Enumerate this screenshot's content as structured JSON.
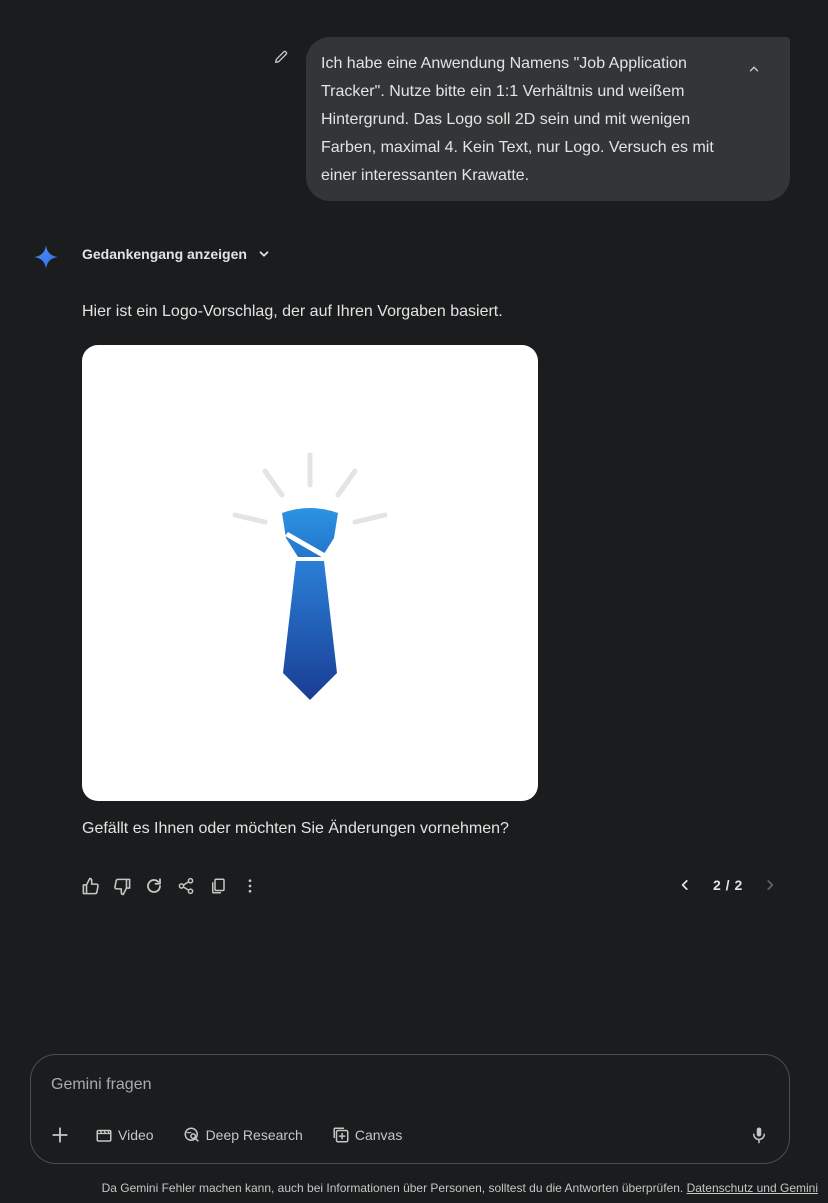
{
  "user_prompt": {
    "text": "Ich habe eine Anwendung Namens \"Job Application Tracker\". Nutze bitte ein 1:1 Verhältnis und weißem Hintergrund. Das Logo soll 2D sein und mit wenigen Farben, maximal 4. Kein Text, nur Logo. Versuch es mit einer interessanten Krawatte."
  },
  "response": {
    "thoughts_label": "Gedankengang anzeigen",
    "intro": "Hier ist ein Logo-Vorschlag, der auf Ihren Vorgaben basiert.",
    "question": "Gefällt es Ihnen oder möchten Sie Änderungen vornehmen?",
    "pager": "2 / 2"
  },
  "input": {
    "placeholder": "Gemini fragen",
    "tools": {
      "video": "Video",
      "deep_research": "Deep Research",
      "canvas": "Canvas"
    }
  },
  "footer": {
    "disclaimer": "Da Gemini Fehler machen kann, auch bei Informationen über Personen, solltest du die Antworten überprüfen.",
    "privacy_link": "Datenschutz und Gemini"
  },
  "colors": {
    "background": "#1b1c1d",
    "bubble": "#333537",
    "accent": "#4285f4",
    "tie_light": "#2b8fe0",
    "tie_dark": "#1a3d94"
  }
}
